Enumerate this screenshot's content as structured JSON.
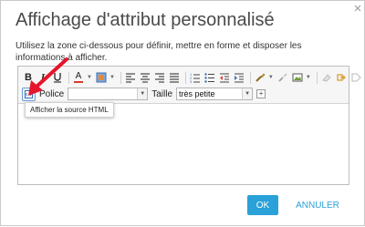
{
  "dialog": {
    "title": "Affichage d'attribut personnalisé",
    "description": "Utilisez la zone ci-dessous pour définir, mettre en forme et disposer les informations à afficher."
  },
  "toolbar": {
    "bold_label": "B",
    "italic_label": "I",
    "font_color_label": "A",
    "font_label": "Police",
    "font_value": "",
    "size_label": "Taille",
    "size_value": "très petite",
    "plus_label": "+"
  },
  "tooltip": {
    "text": "Afficher la source HTML"
  },
  "buttons": {
    "ok": "OK",
    "cancel": "ANNULER"
  },
  "colors": {
    "accent": "#2aa1d8",
    "arrow": "#e5152a",
    "font_color_underline": "#d33c2c"
  }
}
